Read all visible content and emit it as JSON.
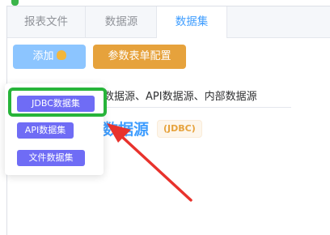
{
  "tabs": [
    "报表文件",
    "数据源",
    "数据集"
  ],
  "active_tab_index": 2,
  "toolbar": {
    "add_label": "添加",
    "param_config_label": "参数表单配置"
  },
  "content": {
    "description": "数据源、API数据源、内部数据源",
    "section_title": "数据源",
    "section_tag": "(JDBC)"
  },
  "dropdown": {
    "items": [
      "JDBC数据集",
      "API数据集",
      "文件数据集"
    ]
  },
  "colors": {
    "accent": "#409eff",
    "add_button": "#8cc5ff",
    "param_button": "#e6a23c",
    "dropdown_item": "#6f6cf5",
    "highlight": "#27b43a",
    "arrow": "#e8322c"
  }
}
